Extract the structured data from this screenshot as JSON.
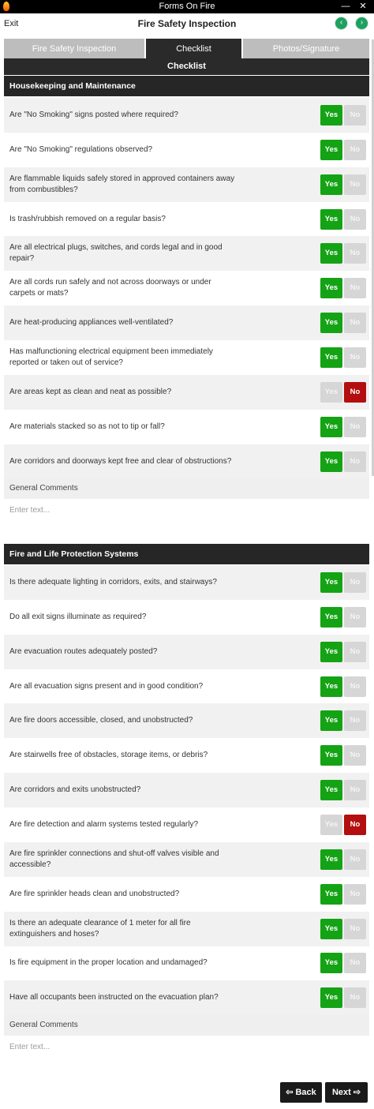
{
  "window": {
    "title": "Forms On Fire",
    "minimize": "—",
    "close": "✕"
  },
  "header": {
    "exit_label": "Exit",
    "title": "Fire Safety Inspection",
    "back_glyph": "‹",
    "forward_glyph": "›"
  },
  "tabs": [
    {
      "label": "Fire Safety Inspection"
    },
    {
      "label": "Checklist"
    },
    {
      "label": "Photos/Signature"
    }
  ],
  "active_tab": "Checklist",
  "subheader": "Checklist",
  "yes_label": "Yes",
  "no_label": "No",
  "colors": {
    "yes_selected": "#14a314",
    "no_selected": "#b30f0f",
    "unselected": "#d6d6d6",
    "header_dark": "#262626"
  },
  "sections": [
    {
      "title": "Housekeeping and Maintenance",
      "questions": [
        {
          "text": "Are \"No Smoking\" signs posted where required?",
          "answer": "Yes"
        },
        {
          "text": "Are \"No Smoking\" regulations observed?",
          "answer": "Yes"
        },
        {
          "text": "Are flammable liquids safely stored in approved containers away from combustibles?",
          "answer": "Yes"
        },
        {
          "text": "Is trash/rubbish removed on a regular basis?",
          "answer": "Yes"
        },
        {
          "text": "Are all electrical plugs, switches, and cords legal and in good repair?",
          "answer": "Yes"
        },
        {
          "text": "Are all cords run safely and not across doorways or under carpets or mats?",
          "answer": "Yes"
        },
        {
          "text": "Are heat-producing appliances well-ventilated?",
          "answer": "Yes"
        },
        {
          "text": "Has malfunctioning electrical equipment been immediately reported or taken out of service?",
          "answer": "Yes"
        },
        {
          "text": "Are areas kept as clean and neat as possible?",
          "answer": "No"
        },
        {
          "text": "Are materials stacked so as not to tip or fall?",
          "answer": "Yes"
        },
        {
          "text": "Are corridors and doorways kept free and clear of obstructions?",
          "answer": "Yes"
        }
      ],
      "comments_label": "General Comments",
      "comments_placeholder": "Enter text..."
    },
    {
      "title": "Fire and Life Protection Systems",
      "questions": [
        {
          "text": "Is there adequate lighting in corridors, exits, and stairways?",
          "answer": "Yes"
        },
        {
          "text": "Do all exit signs illuminate as required?",
          "answer": "Yes"
        },
        {
          "text": "Are evacuation routes adequately posted?",
          "answer": "Yes"
        },
        {
          "text": "Are all evacuation signs present and in good condition?",
          "answer": "Yes"
        },
        {
          "text": "Are fire doors accessible, closed, and unobstructed?",
          "answer": "Yes"
        },
        {
          "text": "Are stairwells free of obstacles, storage items, or debris?",
          "answer": "Yes"
        },
        {
          "text": "Are corridors and exits unobstructed?",
          "answer": "Yes"
        },
        {
          "text": "Are fire detection and alarm systems tested regularly?",
          "answer": "No"
        },
        {
          "text": "Are fire sprinkler connections and shut-off valves visible and accessible?",
          "answer": "Yes"
        },
        {
          "text": "Are fire sprinkler heads clean and unobstructed?",
          "answer": "Yes"
        },
        {
          "text": "Is there an adequate clearance of 1 meter for all fire extinguishers and hoses?",
          "answer": "Yes"
        },
        {
          "text": "Is fire equipment in the proper location and undamaged?",
          "answer": "Yes"
        },
        {
          "text": "Have all occupants been instructed on the evacuation plan?",
          "answer": "Yes"
        }
      ],
      "comments_label": "General Comments",
      "comments_placeholder": "Enter text..."
    }
  ],
  "footer": {
    "back_label": "⇦ Back",
    "next_label": "Next ⇨"
  }
}
